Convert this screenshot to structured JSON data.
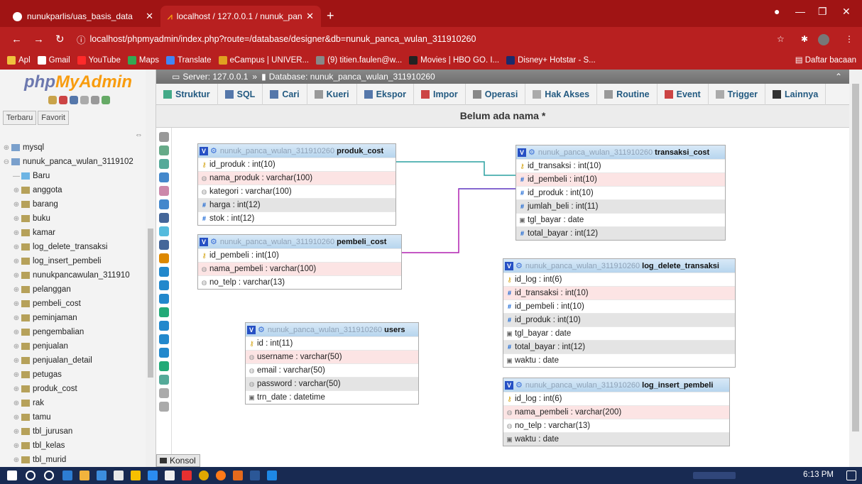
{
  "browser": {
    "tabs": [
      {
        "title": "nunukparlis/uas_basis_data",
        "active": false
      },
      {
        "title": "localhost / 127.0.0.1 / nunuk_pan",
        "active": true
      }
    ],
    "url": "localhost/phpmyadmin/index.php?route=/database/designer&db=nunuk_panca_wulan_311910260",
    "bookmarks": [
      "Apl",
      "Gmail",
      "YouTube",
      "Maps",
      "Translate",
      "eCampus | UNIVER...",
      "(9) titien.faulen@w...",
      "Movies | HBO GO. I...",
      "Disney+ Hotstar - S..."
    ],
    "reading_list": "Daftar bacaan"
  },
  "pma": {
    "logo_php": "php",
    "logo_my": "MyAdmin",
    "fav_tabs": [
      "Terbaru",
      "Favorit"
    ],
    "tree": [
      {
        "label": "mysql",
        "level": 0
      },
      {
        "label": "nunuk_panca_wulan_3119102",
        "level": 0
      },
      {
        "label": "Baru",
        "level": 1
      },
      {
        "label": "anggota",
        "level": 1
      },
      {
        "label": "barang",
        "level": 1
      },
      {
        "label": "buku",
        "level": 1
      },
      {
        "label": "kamar",
        "level": 1
      },
      {
        "label": "log_delete_transaksi",
        "level": 1
      },
      {
        "label": "log_insert_pembeli",
        "level": 1
      },
      {
        "label": "nunukpancawulan_311910",
        "level": 1
      },
      {
        "label": "pelanggan",
        "level": 1
      },
      {
        "label": "pembeli_cost",
        "level": 1
      },
      {
        "label": "peminjaman",
        "level": 1
      },
      {
        "label": "pengembalian",
        "level": 1
      },
      {
        "label": "penjualan",
        "level": 1
      },
      {
        "label": "penjualan_detail",
        "level": 1
      },
      {
        "label": "petugas",
        "level": 1
      },
      {
        "label": "produk_cost",
        "level": 1
      },
      {
        "label": "rak",
        "level": 1
      },
      {
        "label": "tamu",
        "level": 1
      },
      {
        "label": "tbl_jurusan",
        "level": 1
      },
      {
        "label": "tbl_kelas",
        "level": 1
      },
      {
        "label": "tbl_murid",
        "level": 1
      }
    ],
    "breadcrumb": {
      "server": "Server: 127.0.0.1",
      "sep": "»",
      "database": "Database: nunuk_panca_wulan_311910260"
    },
    "menu": [
      "Struktur",
      "SQL",
      "Cari",
      "Kueri",
      "Ekspor",
      "Impor",
      "Operasi",
      "Hak Akses",
      "Routine",
      "Event",
      "Trigger",
      "Lainnya"
    ],
    "page_title": "Belum ada nama *",
    "console": "Konsol",
    "db_prefix": "nunuk_panca_wulan_311910260"
  },
  "tables": [
    {
      "name": "produk_cost",
      "cols": [
        {
          "k": "key",
          "t": "id_produk : int(10)"
        },
        {
          "k": "uniq",
          "t": "nama_produk : varchar(100)"
        },
        {
          "k": "uniq",
          "t": "kategori : varchar(100)"
        },
        {
          "k": "hash",
          "t": "harga : int(12)"
        },
        {
          "k": "hash",
          "t": "stok : int(12)"
        }
      ]
    },
    {
      "name": "pembeli_cost",
      "cols": [
        {
          "k": "key",
          "t": "id_pembeli : int(10)"
        },
        {
          "k": "uniq",
          "t": "nama_pembeli : varchar(100)"
        },
        {
          "k": "uniq",
          "t": "no_telp : varchar(13)"
        }
      ]
    },
    {
      "name": "users",
      "cols": [
        {
          "k": "key",
          "t": "id : int(11)"
        },
        {
          "k": "uniq",
          "t": "username : varchar(50)"
        },
        {
          "k": "uniq",
          "t": "email : varchar(50)"
        },
        {
          "k": "uniq",
          "t": "password : varchar(50)"
        },
        {
          "k": "date",
          "t": "trn_date : datetime"
        }
      ]
    },
    {
      "name": "transaksi_cost",
      "cols": [
        {
          "k": "key",
          "t": "id_transaksi : int(10)"
        },
        {
          "k": "hash",
          "t": "id_pembeli : int(10)"
        },
        {
          "k": "hash",
          "t": "id_produk : int(10)"
        },
        {
          "k": "hash",
          "t": "jumlah_beli : int(11)"
        },
        {
          "k": "date",
          "t": "tgl_bayar : date"
        },
        {
          "k": "hash",
          "t": "total_bayar : int(12)"
        }
      ]
    },
    {
      "name": "log_delete_transaksi",
      "cols": [
        {
          "k": "key",
          "t": "id_log : int(6)"
        },
        {
          "k": "hash",
          "t": "id_transaksi : int(10)"
        },
        {
          "k": "hash",
          "t": "id_pembeli : int(10)"
        },
        {
          "k": "hash",
          "t": "id_produk : int(10)"
        },
        {
          "k": "date",
          "t": "tgl_bayar : date"
        },
        {
          "k": "hash",
          "t": "total_bayar : int(12)"
        },
        {
          "k": "date",
          "t": "waktu : date"
        }
      ]
    },
    {
      "name": "log_insert_pembeli",
      "cols": [
        {
          "k": "key",
          "t": "id_log : int(6)"
        },
        {
          "k": "uniq",
          "t": "nama_pembeli : varchar(200)"
        },
        {
          "k": "uniq",
          "t": "no_telp : varchar(13)"
        },
        {
          "k": "date",
          "t": "waktu : date"
        }
      ]
    }
  ],
  "taskbar": {
    "clock": "6:13 PM"
  }
}
